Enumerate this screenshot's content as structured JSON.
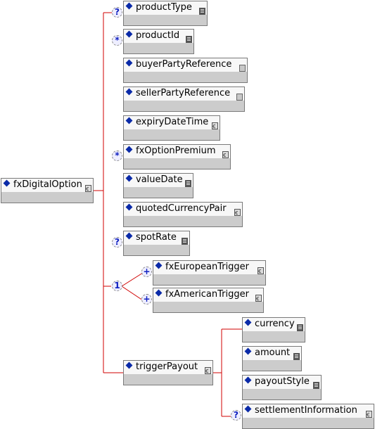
{
  "root": {
    "label": "fxDigitalOption",
    "type": "complex"
  },
  "children": [
    {
      "label": "productType",
      "type": "simple",
      "occurrence": "?"
    },
    {
      "label": "productId",
      "type": "simple",
      "occurrence": "*"
    },
    {
      "label": "buyerPartyReference",
      "type": "empty",
      "occurrence": ""
    },
    {
      "label": "sellerPartyReference",
      "type": "empty",
      "occurrence": ""
    },
    {
      "label": "expiryDateTime",
      "type": "complex",
      "occurrence": ""
    },
    {
      "label": "fxOptionPremium",
      "type": "complex",
      "occurrence": "*"
    },
    {
      "label": "valueDate",
      "type": "simple",
      "occurrence": ""
    },
    {
      "label": "quotedCurrencyPair",
      "type": "complex",
      "occurrence": ""
    },
    {
      "label": "spotRate",
      "type": "simple",
      "occurrence": "?"
    }
  ],
  "choice": {
    "occurrence": "1",
    "options": [
      {
        "label": "fxEuropeanTrigger",
        "type": "complex",
        "occurrence": "+"
      },
      {
        "label": "fxAmericanTrigger",
        "type": "complex",
        "occurrence": "+"
      }
    ]
  },
  "triggerPayout": {
    "label": "triggerPayout",
    "type": "complex",
    "children": [
      {
        "label": "currency",
        "type": "simple",
        "occurrence": ""
      },
      {
        "label": "amount",
        "type": "simple",
        "occurrence": ""
      },
      {
        "label": "payoutStyle",
        "type": "simple",
        "occurrence": ""
      },
      {
        "label": "settlementInformation",
        "type": "complex",
        "occurrence": "?"
      }
    ]
  },
  "colors": {
    "connector": "#d00000",
    "diamond": "#0a2aa8"
  }
}
